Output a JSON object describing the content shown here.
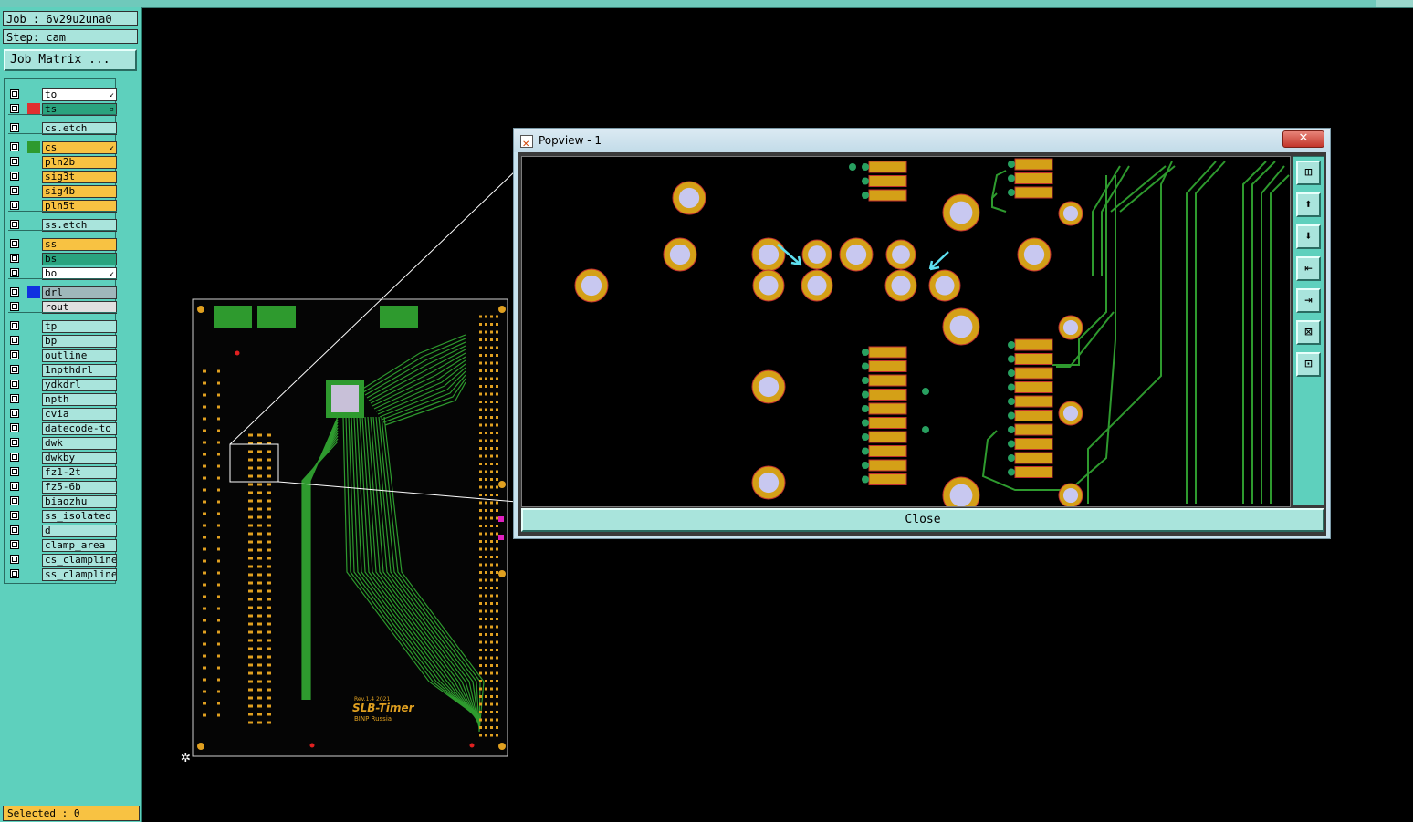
{
  "job_label": "Job : 6v29u2una0",
  "step_label": "Step: cam",
  "job_matrix_button": "Job Matrix ...",
  "layers": [
    {
      "name": "to",
      "bg": "#ffffff",
      "color": "",
      "mark": "↙"
    },
    {
      "name": "ts",
      "bg": "#2aa37e",
      "color": "#e03030",
      "mark": "▫"
    },
    {
      "name": "cs.etch",
      "bg": "#a9e4dc",
      "color": "",
      "mark": ""
    },
    {
      "name": "cs",
      "bg": "#f8c242",
      "color": "#2e9a2e",
      "mark": "↙"
    },
    {
      "name": "pln2b",
      "bg": "#f8c242",
      "color": "",
      "mark": ""
    },
    {
      "name": "sig3t",
      "bg": "#f8c242",
      "color": "",
      "mark": ""
    },
    {
      "name": "sig4b",
      "bg": "#f8c242",
      "color": "",
      "mark": ""
    },
    {
      "name": "pln5t",
      "bg": "#f8c242",
      "color": "",
      "mark": ""
    },
    {
      "name": "ss.etch",
      "bg": "#a9e4dc",
      "color": "",
      "mark": ""
    },
    {
      "name": "ss",
      "bg": "#f8c242",
      "color": "",
      "mark": ""
    },
    {
      "name": "bs",
      "bg": "#2aa37e",
      "color": "",
      "mark": ""
    },
    {
      "name": "bo",
      "bg": "#ffffff",
      "color": "",
      "mark": "↙"
    },
    {
      "name": "drl",
      "bg": "#9fb7bb",
      "color": "#1030e0",
      "mark": ""
    },
    {
      "name": "rout",
      "bg": "#e0e0e0",
      "color": "",
      "mark": ""
    },
    {
      "name": "tp",
      "bg": "#a9e4dc",
      "color": "",
      "mark": ""
    },
    {
      "name": "bp",
      "bg": "#a9e4dc",
      "color": "",
      "mark": ""
    },
    {
      "name": "outline",
      "bg": "#a9e4dc",
      "color": "",
      "mark": ""
    },
    {
      "name": "1npthdrl",
      "bg": "#a9e4dc",
      "color": "",
      "mark": ""
    },
    {
      "name": "ydkdrl",
      "bg": "#a9e4dc",
      "color": "",
      "mark": ""
    },
    {
      "name": "npth",
      "bg": "#a9e4dc",
      "color": "",
      "mark": ""
    },
    {
      "name": "cvia",
      "bg": "#a9e4dc",
      "color": "",
      "mark": ""
    },
    {
      "name": "datecode-to",
      "bg": "#a9e4dc",
      "color": "",
      "mark": ""
    },
    {
      "name": "dwk",
      "bg": "#a9e4dc",
      "color": "",
      "mark": ""
    },
    {
      "name": "dwkby",
      "bg": "#a9e4dc",
      "color": "",
      "mark": ""
    },
    {
      "name": "fz1-2t",
      "bg": "#a9e4dc",
      "color": "",
      "mark": ""
    },
    {
      "name": "fz5-6b",
      "bg": "#a9e4dc",
      "color": "",
      "mark": ""
    },
    {
      "name": "biaozhu",
      "bg": "#a9e4dc",
      "color": "",
      "mark": ""
    },
    {
      "name": "ss_isolated",
      "bg": "#a9e4dc",
      "color": "",
      "mark": ""
    },
    {
      "name": "d",
      "bg": "#a9e4dc",
      "color": "",
      "mark": ""
    },
    {
      "name": "clamp_area",
      "bg": "#a9e4dc",
      "color": "",
      "mark": ""
    },
    {
      "name": "cs_clampline",
      "bg": "#a9e4dc",
      "color": "",
      "mark": ""
    },
    {
      "name": "ss_clampline",
      "bg": "#a9e4dc",
      "color": "",
      "mark": ""
    }
  ],
  "status": "Selected : 0",
  "board": {
    "rev": "Rev.1.4  2021",
    "name": "SLB-Timer",
    "org": "BINP Russia"
  },
  "popview": {
    "title": "Popview - 1",
    "close_x": "✕",
    "close_button": "Close",
    "tools": [
      "fit-icon",
      "pan-up-icon",
      "pan-down-icon",
      "pan-left-icon",
      "pan-right-icon",
      "zoom-in-icon",
      "zoom-out-icon"
    ]
  },
  "colors": {
    "panel": "#5ed0bd",
    "copper": "#d4a017",
    "trace": "#2e9a2e",
    "drill": "#c8c8f0"
  }
}
